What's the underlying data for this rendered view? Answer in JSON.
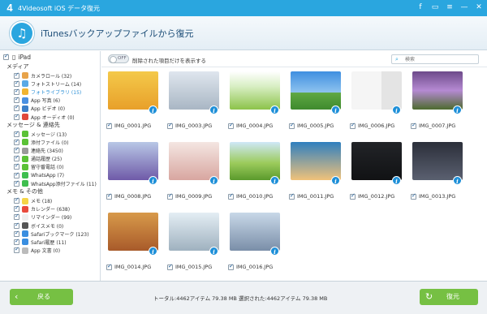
{
  "app": {
    "title": "4Videosoft iOS データ復元",
    "logo": "4"
  },
  "header": {
    "title": "iTunesバックアップファイルから復元"
  },
  "sidebar": {
    "device": "iPad",
    "sections": [
      {
        "label": "メディア",
        "items": [
          {
            "label": "カメラロール (32)",
            "color": "#e8a34a"
          },
          {
            "label": "フォトストリーム (14)",
            "color": "#5aa9e6"
          },
          {
            "label": "フォトライブラリ (15)",
            "color": "#f0b433"
          },
          {
            "label": "App 写真 (6)",
            "color": "#4a90e2"
          },
          {
            "label": "App ビデオ (0)",
            "color": "#3c7fc9"
          },
          {
            "label": "App オーディオ (0)",
            "color": "#e0483c"
          }
        ]
      },
      {
        "label": "メッセージ & 連絡先",
        "items": [
          {
            "label": "メッセージ (13)",
            "color": "#5bc236"
          },
          {
            "label": "添付ファイル (0)",
            "color": "#5bc236"
          },
          {
            "label": "連絡先 (3450)",
            "color": "#9a9a9a"
          },
          {
            "label": "通話履歴 (25)",
            "color": "#5bc236"
          },
          {
            "label": "留守番電話 (0)",
            "color": "#5bc236"
          },
          {
            "label": "WhatsApp (7)",
            "color": "#3fbf4f"
          },
          {
            "label": "WhatsApp添付ファイル (11)",
            "color": "#3fbf4f"
          }
        ]
      },
      {
        "label": "メモ & その他",
        "items": [
          {
            "label": "メモ (18)",
            "color": "#f5d547"
          },
          {
            "label": "カレンダー (638)",
            "color": "#e84a3c"
          },
          {
            "label": "リマインダー (99)",
            "color": "#eeeeee"
          },
          {
            "label": "ボイスメモ (0)",
            "color": "#555555"
          },
          {
            "label": "Safariブックマーク (123)",
            "color": "#3a8ee0"
          },
          {
            "label": "Safari履歴 (11)",
            "color": "#3a8ee0"
          },
          {
            "label": "App 文書 (0)",
            "color": "#bbbbbb"
          }
        ]
      }
    ]
  },
  "toolbar": {
    "toggle_label": "OFF",
    "toggle_text": "削除された項目だけを表示する",
    "search_placeholder": "検索"
  },
  "photos": [
    {
      "name": "IMG_0001.JPG",
      "bg": "linear-gradient(#f4c94a, #e8a02a)"
    },
    {
      "name": "IMG_0003.JPG",
      "bg": "linear-gradient(#dfe6ee, #a9b6c4)"
    },
    {
      "name": "IMG_0004.JPG",
      "bg": "linear-gradient(#ffffff 0%, #d7eec2 40%, #8cc34a 100%)"
    },
    {
      "name": "IMG_0005.JPG",
      "bg": "linear-gradient(#3f8fe0 0%, #8ec3ef 55%, #5fa843 56%, #3f8a2e 100%)"
    },
    {
      "name": "IMG_0006.JPG",
      "bg": "linear-gradient(90deg, #f5f5f5 60%, #e4e4e4 60%)"
    },
    {
      "name": "IMG_0007.JPG",
      "bg": "linear-gradient(#6d4a8a 0%, #b58ad2 50%, #4d6b2e 100%)"
    },
    {
      "name": "IMG_0008.JPG",
      "bg": "linear-gradient(#b8c7e6, #6f5aa8)"
    },
    {
      "name": "IMG_0009.JPG",
      "bg": "linear-gradient(#f4e6e2, #d8a6a0)"
    },
    {
      "name": "IMG_0010.JPG",
      "bg": "linear-gradient(#cfe8f8 0%, #9ccb5c 55%, #5a9a2c 100%)"
    },
    {
      "name": "IMG_0011.JPG",
      "bg": "linear-gradient(#2f7fbf, #f0c27a)"
    },
    {
      "name": "IMG_0012.JPG",
      "bg": "linear-gradient(#222428, #111214)"
    },
    {
      "name": "IMG_0013.JPG",
      "bg": "linear-gradient(#2b2f3a, #5a6070)"
    },
    {
      "name": "IMG_0014.JPG",
      "bg": "linear-gradient(#d89a4a, #a85a2a)"
    },
    {
      "name": "IMG_0015.JPG",
      "bg": "linear-gradient(#e4eef4, #9fb1bf)"
    },
    {
      "name": "IMG_0016.JPG",
      "bg": "linear-gradient(#c8d8e8, #7a8ea8)"
    }
  ],
  "footer": {
    "back_label": "戻る",
    "summary": "トータル:4462アイテム 79.38 MB   選択された:4462アイテム 79.38 MB",
    "recover_label": "復元"
  }
}
